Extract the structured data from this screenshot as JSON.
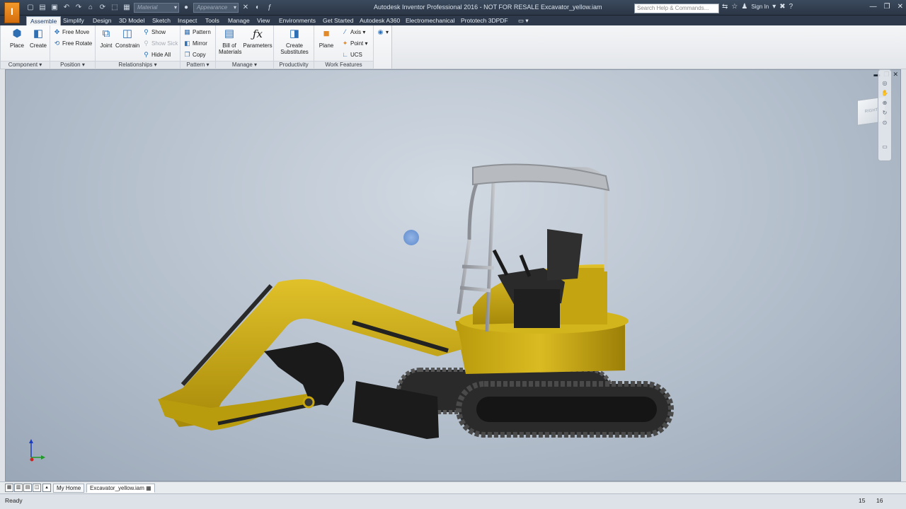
{
  "titlebar": {
    "app_logo": "I",
    "title": "Autodesk Inventor Professional 2016 - NOT FOR RESALE    Excavator_yellow.iam",
    "material_combo": "Material",
    "appearance_combo": "Appearance",
    "search_placeholder": "Search Help & Commands...",
    "sign_in": "Sign In"
  },
  "tabs": [
    {
      "label": "Assemble",
      "active": true
    },
    {
      "label": "Simplify"
    },
    {
      "label": "Design"
    },
    {
      "label": "3D Model"
    },
    {
      "label": "Sketch"
    },
    {
      "label": "Inspect"
    },
    {
      "label": "Tools"
    },
    {
      "label": "Manage"
    },
    {
      "label": "View"
    },
    {
      "label": "Environments"
    },
    {
      "label": "Get Started"
    },
    {
      "label": "Autodesk A360"
    },
    {
      "label": "Electromechanical"
    },
    {
      "label": "Prototech 3DPDF"
    }
  ],
  "ribbon": {
    "component": {
      "title": "Component",
      "place": "Place",
      "create": "Create"
    },
    "position": {
      "title": "Position",
      "free_move": "Free Move",
      "free_rotate": "Free Rotate"
    },
    "relationships": {
      "title": "Relationships",
      "joint": "Joint",
      "constrain": "Constrain",
      "show": "Show",
      "show_sick": "Show Sick",
      "hide_all": "Hide All"
    },
    "pattern": {
      "title": "Pattern",
      "pattern": "Pattern",
      "mirror": "Mirror",
      "copy": "Copy"
    },
    "manage": {
      "title": "Manage",
      "bill_line1": "Bill of",
      "bill_line2": "Materials",
      "parameters": "Parameters"
    },
    "productivity": {
      "title": "Productivity",
      "create_sub_line1": "Create",
      "create_sub_line2": "Substitutes"
    },
    "work_features": {
      "title": "Work Features",
      "plane": "Plane",
      "axis": "Axis",
      "point": "Point",
      "ucs": "UCS"
    }
  },
  "viewcube": {
    "face_label": "RIGHT"
  },
  "document_tabs": {
    "home": "My Home",
    "file": "Excavator_yellow.iam"
  },
  "status": {
    "text": "Ready",
    "num1": "15",
    "num2": "16"
  },
  "colors": {
    "excavator_yellow": "#c9a70f",
    "excavator_dark": "#1c1c1c",
    "cab_frame": "#9a9ea3"
  }
}
